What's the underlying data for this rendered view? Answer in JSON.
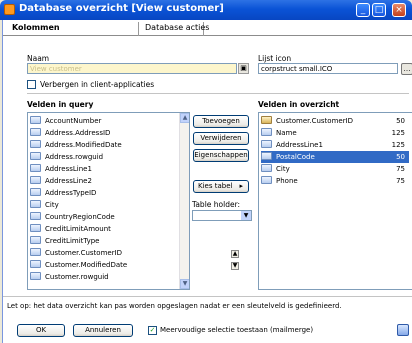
{
  "window": {
    "title": "Database overzicht [View customer]"
  },
  "tabs": [
    {
      "label": "Kolommen"
    },
    {
      "label": "Database acties"
    }
  ],
  "form": {
    "name_label": "Naam",
    "name_value": "View customer",
    "icon_label": "Lijst icon",
    "icon_value": "corpstruct small.ICO",
    "hide_checkbox_label": "Verbergen in client-applicaties"
  },
  "query": {
    "title": "Velden in query",
    "fields": [
      "AccountNumber",
      "Address.AddressID",
      "Address.ModifiedDate",
      "Address.rowguid",
      "AddressLine1",
      "AddressLine2",
      "AddressTypeID",
      "City",
      "CountryRegionCode",
      "CreditLimitAmount",
      "CreditLimitType",
      "Customer.CustomerID",
      "Customer.ModifiedDate",
      "Customer.rowguid"
    ]
  },
  "actions": {
    "add": "Toevoegen",
    "remove": "Verwijderen",
    "properties": "Eigenschappen",
    "choose_table": "Kies tabel",
    "table_holder_label": "Table holder:"
  },
  "overview": {
    "title": "Velden in overzicht",
    "rows": [
      {
        "name": "Customer.CustomerID",
        "width": "50"
      },
      {
        "name": "Name",
        "width": "125"
      },
      {
        "name": "AddressLine1",
        "width": "125"
      },
      {
        "name": "PostalCode",
        "width": "50"
      },
      {
        "name": "City",
        "width": "75"
      },
      {
        "name": "Phone",
        "width": "75"
      }
    ]
  },
  "footer": {
    "note": "Let op: het data overzicht kan pas worden opgeslagen nadat er een sleutelveld is gedefinieerd.",
    "ok": "OK",
    "cancel": "Annuleren",
    "multi_select_label": "Meervoudige selectie toestaan (mailmerge)"
  },
  "icons": {
    "window": "app-icon",
    "lock": "lock-icon",
    "browse": "ellipsis-icon",
    "field": "field-icon",
    "key": "key-icon",
    "help": "help-icon"
  },
  "colors": {
    "titlebar": "#0a53d6",
    "selection": "#316ac5",
    "name_field_bg": "#fdf6cc"
  }
}
